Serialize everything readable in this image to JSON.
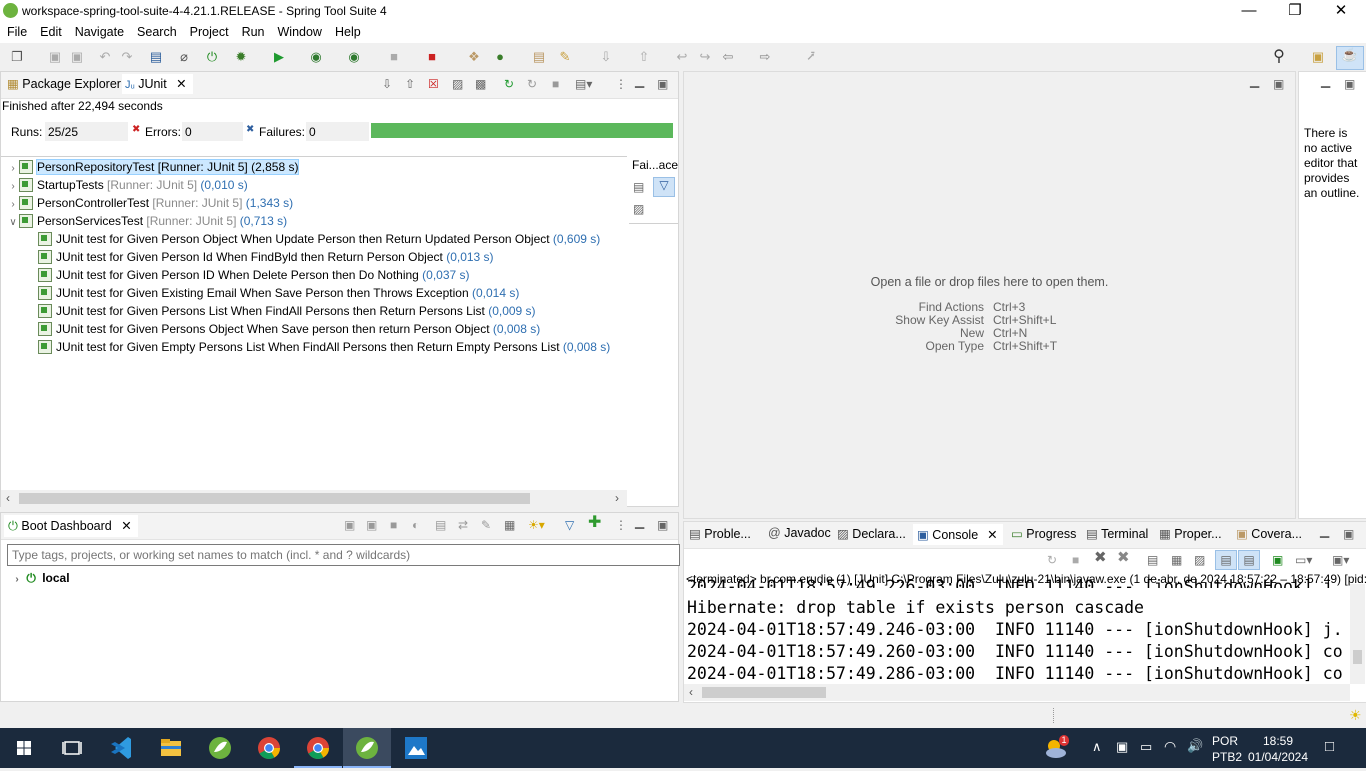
{
  "window": {
    "title": "workspace-spring-tool-suite-4-4.21.1.RELEASE - Spring Tool Suite 4"
  },
  "menu": [
    "File",
    "Edit",
    "Navigate",
    "Search",
    "Project",
    "Run",
    "Window",
    "Help"
  ],
  "left_top": {
    "tabs": {
      "package_explorer": "Package Explorer",
      "junit": "JUnit"
    },
    "finished": "Finished after 22,494 seconds",
    "runs_label": "Runs:",
    "runs_value": "25/25",
    "errors_label": "Errors:",
    "errors_value": "0",
    "failures_label": "Failures:",
    "failures_value": "0",
    "progress": 1.0,
    "trace_label": "Fai...ace",
    "tree": [
      {
        "name": "PersonRepositoryTest",
        "runner": "[Runner: JUnit 5]",
        "time": "(2,858 s)",
        "expanded": false,
        "selected": true
      },
      {
        "name": "StartupTests",
        "runner": "[Runner: JUnit 5]",
        "time": "(0,010 s)",
        "expanded": false
      },
      {
        "name": "PersonControllerTest",
        "runner": "[Runner: JUnit 5]",
        "time": "(1,343 s)",
        "expanded": false
      },
      {
        "name": "PersonServicesTest",
        "runner": "[Runner: JUnit 5]",
        "time": "(0,713 s)",
        "expanded": true
      }
    ],
    "children": [
      {
        "name": "JUnit test for Given Person Object When Update Person then Return Updated Person Object",
        "time": "(0,609 s)"
      },
      {
        "name": "JUnit test for Given Person Id When FindByld then Return Person Object",
        "time": "(0,013 s)"
      },
      {
        "name": "JUnit test for Given Person ID When Delete Person then Do Nothing",
        "time": "(0,037 s)"
      },
      {
        "name": "JUnit test for Given Existing Email When Save Person then Throws Exception",
        "time": "(0,014 s)"
      },
      {
        "name": "JUnit test for Given Persons List When FindAll Persons then Return Persons List",
        "time": "(0,009 s)"
      },
      {
        "name": "JUnit test for Given Persons Object When Save person then return Person Object",
        "time": "(0,008 s)"
      },
      {
        "name": "JUnit test for Given Empty Persons List When FindAll Persons then Return Empty Persons List",
        "time": "(0,008 s)"
      }
    ]
  },
  "boot": {
    "tab": "Boot Dashboard",
    "filter_placeholder": "Type tags, projects, or working set names to match (incl. * and ? wildcards)",
    "item": "local"
  },
  "editor": {
    "empty_msg": "Open a file or drop files here to open them.",
    "shortcuts": [
      {
        "action": "Find Actions",
        "keys": "Ctrl+3"
      },
      {
        "action": "Show Key Assist",
        "keys": "Ctrl+Shift+L"
      },
      {
        "action": "New",
        "keys": "Ctrl+N"
      },
      {
        "action": "Open Type",
        "keys": "Ctrl+Shift+T"
      }
    ]
  },
  "outline": {
    "msg_lines": [
      "There is",
      "no active",
      "editor that",
      "provides",
      "an outline."
    ]
  },
  "bottom": {
    "tabs": {
      "problems": "Proble...",
      "javadoc": "Javadoc",
      "declaration": "Declara...",
      "console": "Console",
      "progress": "Progress",
      "terminal": "Terminal",
      "properties": "Proper...",
      "coverage": "Covera..."
    },
    "terminated": "<terminated> br.com.erudio (1) [JUnit] C:\\Program Files\\Zulu\\zulu-21\\bin\\javaw.exe  (1 de abr. de 2024 18:57:22 – 18:57:49) [pid:",
    "partial_line": "2024-04-01T18:57:49.226-03:00  INFO 11140 --- [ionShutdownHook] j.",
    "lines": [
      "Hibernate: drop table if exists person cascade",
      "2024-04-01T18:57:49.246-03:00  INFO 11140 --- [ionShutdownHook] j.",
      "2024-04-01T18:57:49.260-03:00  INFO 11140 --- [ionShutdownHook] co",
      "2024-04-01T18:57:49.286-03:00  INFO 11140 --- [ionShutdownHook] co"
    ]
  },
  "taskbar": {
    "lang": "POR",
    "layout": "PTB2",
    "time": "18:59",
    "date": "01/04/2024",
    "weather_badge": "1"
  }
}
